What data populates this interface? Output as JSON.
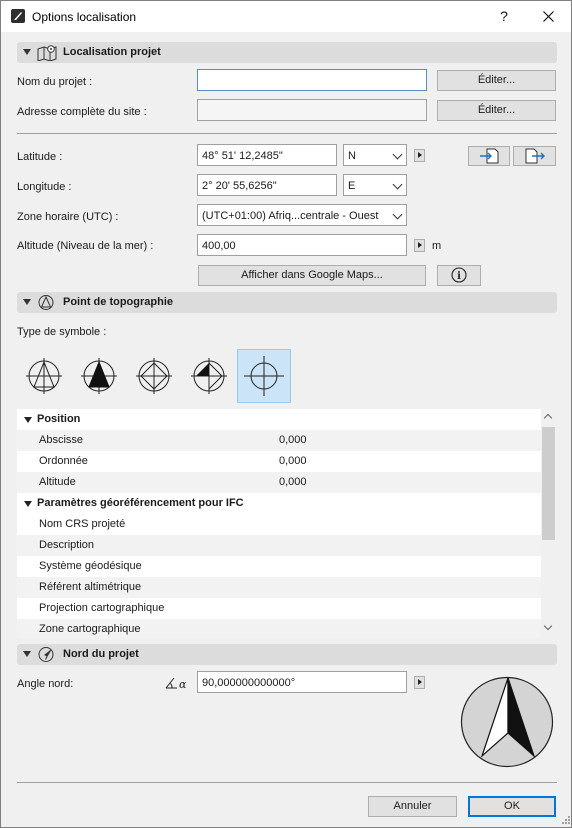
{
  "window": {
    "title": "Options localisation",
    "help_label": "?",
    "close_label": "✕"
  },
  "project_location": {
    "section_title": "Localisation projet",
    "project_name_label": "Nom du projet :",
    "project_name_value": "",
    "site_address_label": "Adresse complète du site :",
    "site_address_value": "",
    "edit_label": "Éditer...",
    "latitude_label": "Latitude :",
    "latitude_value": "48° 51' 12,2485\"",
    "latitude_hemisphere": "N",
    "longitude_label": "Longitude :",
    "longitude_value": "2° 20' 55,6256\"",
    "longitude_hemisphere": "E",
    "timezone_label": "Zone horaire (UTC) :",
    "timezone_value": "(UTC+01:00) Afriq...centrale - Ouest",
    "altitude_label": "Altitude (Niveau de la mer) :",
    "altitude_value": "400,00",
    "altitude_unit": "m",
    "google_maps_label": "Afficher dans Google Maps...",
    "info_icon_label": "i"
  },
  "survey_point": {
    "section_title": "Point de topographie",
    "symbol_type_label": "Type de symbole :",
    "symbols": [
      "survey-symbol-1",
      "survey-symbol-2",
      "survey-symbol-3",
      "survey-symbol-4",
      "survey-symbol-5"
    ],
    "selected_symbol_index": 4,
    "grid": {
      "groups": [
        {
          "title": "Position",
          "rows": [
            {
              "name": "Abscisse",
              "value": "0,000"
            },
            {
              "name": "Ordonnée",
              "value": "0,000"
            },
            {
              "name": "Altitude",
              "value": "0,000"
            }
          ]
        },
        {
          "title": "Paramètres géoréférencement pour IFC",
          "rows": [
            {
              "name": "Nom CRS projeté",
              "value": ""
            },
            {
              "name": "Description",
              "value": ""
            },
            {
              "name": "Système géodésique",
              "value": ""
            },
            {
              "name": "Référent altimétrique",
              "value": ""
            },
            {
              "name": "Projection cartographique",
              "value": ""
            },
            {
              "name": "Zone cartographique",
              "value": ""
            }
          ]
        }
      ]
    }
  },
  "project_north": {
    "section_title": "Nord du projet",
    "angle_label": "Angle nord:",
    "angle_icon_text": "α",
    "angle_value": "90,000000000000°"
  },
  "footer": {
    "cancel_label": "Annuler",
    "ok_label": "OK"
  },
  "colors": {
    "accent": "#0078d7",
    "selection": "#cce4f7",
    "section_bar": "#dcdcdc"
  }
}
